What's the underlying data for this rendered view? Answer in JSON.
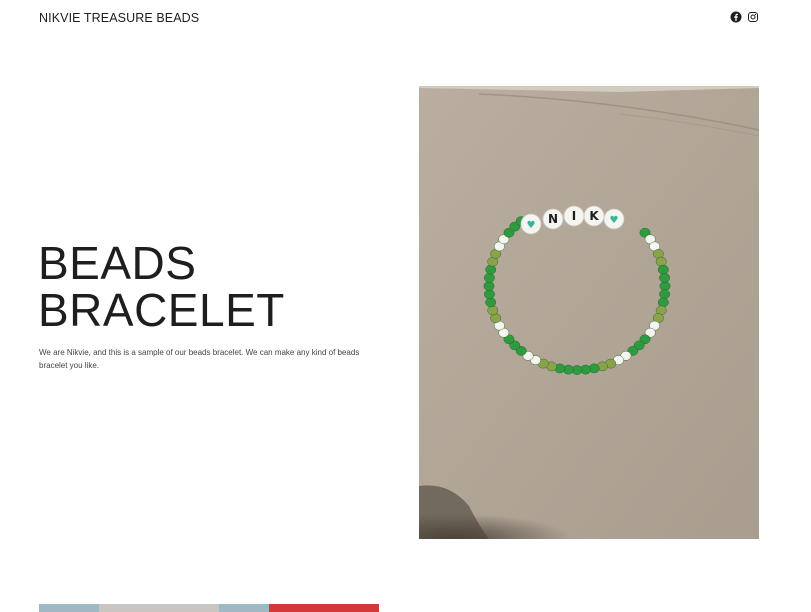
{
  "header": {
    "site_title": "NIKVIE TREASURE BEADS",
    "social": [
      {
        "icon": "facebook-icon"
      },
      {
        "icon": "instagram-icon"
      }
    ]
  },
  "hero": {
    "title_line1": "BEADS",
    "title_line2": "BRACELET",
    "description": "We are Nikvie, and this is a sample of our beads bracelet. We can make any kind of beads bracelet you like.",
    "bracelet_letters": [
      "N",
      "I",
      "K"
    ]
  },
  "colors": {
    "text": "#1e1e1e",
    "cardboard": "#b3a89b",
    "bead_green": "#2f9a3f",
    "bead_olive": "#8aa24a",
    "bead_white": "#f4f4f0",
    "heart": "#3cb394"
  }
}
